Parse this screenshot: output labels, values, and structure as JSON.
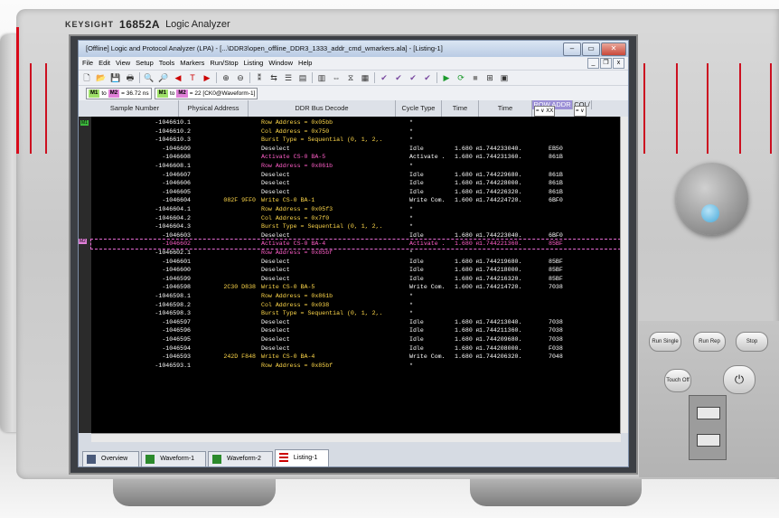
{
  "device": {
    "brand": "KEYSIGHT",
    "model": "16852A",
    "product_name": "Logic Analyzer"
  },
  "window": {
    "title": "[Offline] Logic and Protocol Analyzer (LPA) - [...\\DDR3\\open_offline_DDR3_1333_addr_cmd_wmarkers.ala] - [Listing-1]",
    "menu": [
      "File",
      "Edit",
      "View",
      "Setup",
      "Tools",
      "Markers",
      "Run/Stop",
      "Listing",
      "Window",
      "Help"
    ]
  },
  "markers": {
    "m1_label": "M1",
    "to_text": "to",
    "m2_label": "M2",
    "delta_time": "= 36.72 ns",
    "m1b_label": "M1",
    "to_text_b": "to",
    "m2b_label": "M2",
    "delta_samples": "= 22 [CK0@Waveform-1]"
  },
  "columns": {
    "sample_number": "Sample Number",
    "physical_address": "Physical Address",
    "ddr_bus_decode": "DDR Bus Decode",
    "cycle_type": "Cycle Type",
    "time": "Time",
    "time2": "Time",
    "row_addr": "ROW ADDR",
    "col": "COL/",
    "filter_value": "= ∨ XX"
  },
  "rows": [
    {
      "sn": "-1046610.1",
      "pa": "",
      "dd": "Row Address = 0x05bb",
      "ct": "*",
      "tm": "",
      "t2": "",
      "rw": "",
      "cls": "clr-yellow"
    },
    {
      "sn": "-1046610.2",
      "pa": "",
      "dd": "Col Address = 0x750",
      "ct": "*",
      "tm": "",
      "t2": "",
      "rw": "",
      "cls": "clr-yellow"
    },
    {
      "sn": "-1046610.3",
      "pa": "",
      "dd": "Burst Type = Sequential (0, 1, 2,.",
      "ct": "*",
      "tm": "",
      "t2": "",
      "rw": "",
      "cls": "clr-yellow"
    },
    {
      "sn": "-1046609",
      "pa": "",
      "dd": "Deselect",
      "ct": "Idle",
      "tm": "1.680 n",
      "t2": "-1.744233040.",
      "rw": "EB50",
      "cls": "clr-white"
    },
    {
      "sn": "-1046608",
      "pa": "",
      "dd": "Activate      CS-0  BA-5",
      "ct": "Activate .",
      "tm": "1.680 n",
      "t2": "-1.744231360.",
      "rw": "861B",
      "cls": "clr-pink"
    },
    {
      "sn": "-1046608.1",
      "pa": "",
      "dd": "Row Address = 0x861b",
      "ct": "*",
      "tm": "",
      "t2": "",
      "rw": "",
      "cls": "clr-pink"
    },
    {
      "sn": "-1046607",
      "pa": "",
      "dd": "Deselect",
      "ct": "Idle",
      "tm": "1.680 n",
      "t2": "-1.744229680.",
      "rw": "861B",
      "cls": "clr-white"
    },
    {
      "sn": "-1046606",
      "pa": "",
      "dd": "Deselect",
      "ct": "Idle",
      "tm": "1.680 n",
      "t2": "-1.744228000.",
      "rw": "861B",
      "cls": "clr-white"
    },
    {
      "sn": "-1046605",
      "pa": "",
      "dd": "Deselect",
      "ct": "Idle",
      "tm": "1.680 n",
      "t2": "-1.744226320.",
      "rw": "861B",
      "cls": "clr-white"
    },
    {
      "sn": "-1046604",
      "pa": "082F 9FF0",
      "dd": "Write         CS-0  BA-1",
      "ct": "Write Com.",
      "tm": "1.600 n",
      "t2": "-1.744224720.",
      "rw": "6BF0",
      "cls": "clr-yellow"
    },
    {
      "sn": "-1046604.1",
      "pa": "",
      "dd": "Row Address = 0x05f3",
      "ct": "*",
      "tm": "",
      "t2": "",
      "rw": "",
      "cls": "clr-yellow"
    },
    {
      "sn": "-1046604.2",
      "pa": "",
      "dd": "Col Address = 0x7f0",
      "ct": "*",
      "tm": "",
      "t2": "",
      "rw": "",
      "cls": "clr-yellow"
    },
    {
      "sn": "-1046604.3",
      "pa": "",
      "dd": "Burst Type = Sequential (0, 1, 2,.",
      "ct": "*",
      "tm": "",
      "t2": "",
      "rw": "",
      "cls": "clr-yellow"
    },
    {
      "sn": "-1046603",
      "pa": "",
      "dd": "Deselect",
      "ct": "Idle",
      "tm": "1.680 n",
      "t2": "-1.744223040.",
      "rw": "6BF0",
      "cls": "clr-white"
    },
    {
      "sn": "-1046602",
      "pa": "",
      "dd": "Activate      CS-0  BA-4",
      "ct": "Activate .",
      "tm": "1.680 n",
      "t2": "-1.744221360.",
      "rw": "85BF",
      "cls": "m2sel"
    },
    {
      "sn": "-1046602.1",
      "pa": "",
      "dd": "Row Address = 0x85bf",
      "ct": "*",
      "tm": "",
      "t2": "",
      "rw": "",
      "cls": "clr-pink"
    },
    {
      "sn": "-1046601",
      "pa": "",
      "dd": "Deselect",
      "ct": "Idle",
      "tm": "1.680 n",
      "t2": "-1.744219680.",
      "rw": "85BF",
      "cls": "clr-white"
    },
    {
      "sn": "-1046600",
      "pa": "",
      "dd": "Deselect",
      "ct": "Idle",
      "tm": "1.680 n",
      "t2": "-1.744218000.",
      "rw": "85BF",
      "cls": "clr-white"
    },
    {
      "sn": "-1046599",
      "pa": "",
      "dd": "Deselect",
      "ct": "Idle",
      "tm": "1.680 n",
      "t2": "-1.744216320.",
      "rw": "85BF",
      "cls": "clr-white"
    },
    {
      "sn": "-1046598",
      "pa": "2C30 D838",
      "dd": "Write         CS-0  BA-5",
      "ct": "Write Com.",
      "tm": "1.600 n",
      "t2": "-1.744214720.",
      "rw": "7038",
      "cls": "clr-yellow"
    },
    {
      "sn": "-1046598.1",
      "pa": "",
      "dd": "Row Address = 0x861b",
      "ct": "*",
      "tm": "",
      "t2": "",
      "rw": "",
      "cls": "clr-yellow"
    },
    {
      "sn": "-1046598.2",
      "pa": "",
      "dd": "Col Address = 0x038",
      "ct": "*",
      "tm": "",
      "t2": "",
      "rw": "",
      "cls": "clr-yellow"
    },
    {
      "sn": "-1046598.3",
      "pa": "",
      "dd": "Burst Type = Sequential (0, 1, 2,.",
      "ct": "*",
      "tm": "",
      "t2": "",
      "rw": "",
      "cls": "clr-yellow"
    },
    {
      "sn": "-1046597",
      "pa": "",
      "dd": "Deselect",
      "ct": "Idle",
      "tm": "1.680 n",
      "t2": "-1.744213040.",
      "rw": "7038",
      "cls": "clr-white"
    },
    {
      "sn": "-1046596",
      "pa": "",
      "dd": "Deselect",
      "ct": "Idle",
      "tm": "1.680 n",
      "t2": "-1.744211360.",
      "rw": "7038",
      "cls": "clr-white"
    },
    {
      "sn": "-1046595",
      "pa": "",
      "dd": "Deselect",
      "ct": "Idle",
      "tm": "1.680 n",
      "t2": "-1.744209680.",
      "rw": "7038",
      "cls": "clr-white"
    },
    {
      "sn": "-1046594",
      "pa": "",
      "dd": "Deselect",
      "ct": "Idle",
      "tm": "1.680 n",
      "t2": "-1.744208000.",
      "rw": "F038",
      "cls": "clr-white"
    },
    {
      "sn": "-1046593",
      "pa": "242D F848",
      "dd": "Write         CS-0  BA-4",
      "ct": "Write Com.",
      "tm": "1.680 n",
      "t2": "-1.744206320.",
      "rw": "7048",
      "cls": "clr-yellow"
    },
    {
      "sn": "-1046593.1",
      "pa": "",
      "dd": "Row Address = 0x85bf",
      "ct": "*",
      "tm": "",
      "t2": "",
      "rw": "",
      "cls": "clr-yellow"
    }
  ],
  "gutter_markers": {
    "m1": "M1",
    "m2": "M2"
  },
  "tabs": [
    "Overview",
    "Waveform-1",
    "Waveform-2",
    "Listing-1"
  ],
  "panel_buttons": {
    "run_single": "Run Single",
    "run_rep": "Run Rep",
    "stop": "Stop",
    "touch_off": "Touch Off"
  }
}
